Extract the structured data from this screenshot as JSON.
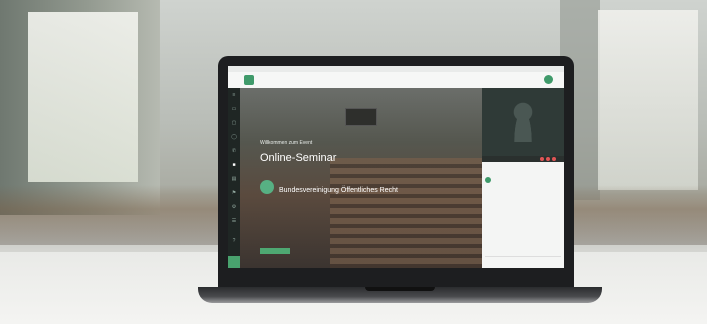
{
  "scene": {
    "description_colors": {
      "wall": "#8c918a",
      "desk": "#eeeeec",
      "laptop": "#1d1e20"
    }
  },
  "app": {
    "menubar_items": [
      "",
      "",
      "",
      "",
      "",
      "",
      ""
    ],
    "brand_line1": "",
    "brand_line2": "",
    "tagline": "",
    "header_items": [
      "",
      "",
      "",
      ""
    ],
    "accent_color": "#3f9a6a"
  },
  "stage": {
    "notice": "",
    "welcome": "Willkommen zum Event",
    "title": "Online-Seminar",
    "host_label": "",
    "host_name": "Bundesvereinigung Öffentliches Recht",
    "cta_label": ""
  },
  "panel": {
    "header": "",
    "row1": "",
    "participant": "",
    "empty_title": "",
    "empty_sub": "",
    "input_placeholder": ""
  },
  "sidebar_icons": [
    "menu-icon",
    "video-icon",
    "screen-icon",
    "chat-icon",
    "phone-icon",
    "camera-icon",
    "doc-icon",
    "flag-icon",
    "settings-icon",
    "users-icon"
  ]
}
